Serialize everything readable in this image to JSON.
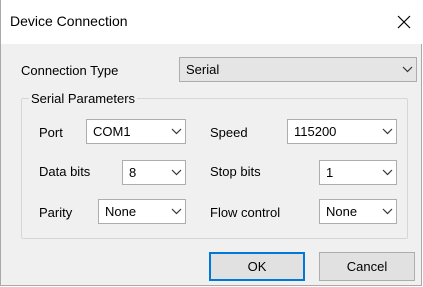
{
  "window": {
    "title": "Device Connection"
  },
  "connection": {
    "label": "Connection Type",
    "value": "Serial"
  },
  "group": {
    "title": "Serial Parameters"
  },
  "fields": {
    "port": {
      "label": "Port",
      "value": "COM1"
    },
    "speed": {
      "label": "Speed",
      "value": "115200"
    },
    "data_bits": {
      "label": "Data bits",
      "value": "8"
    },
    "stop_bits": {
      "label": "Stop bits",
      "value": "1"
    },
    "parity": {
      "label": "Parity",
      "value": "None"
    },
    "flow_control": {
      "label": "Flow control",
      "value": "None"
    }
  },
  "buttons": {
    "ok": "OK",
    "cancel": "Cancel"
  },
  "icons": {
    "close": "close-icon",
    "dropdown": "chevron-down-icon"
  },
  "colors": {
    "accent": "#0078d7",
    "window_bg": "#f0f0f0"
  }
}
